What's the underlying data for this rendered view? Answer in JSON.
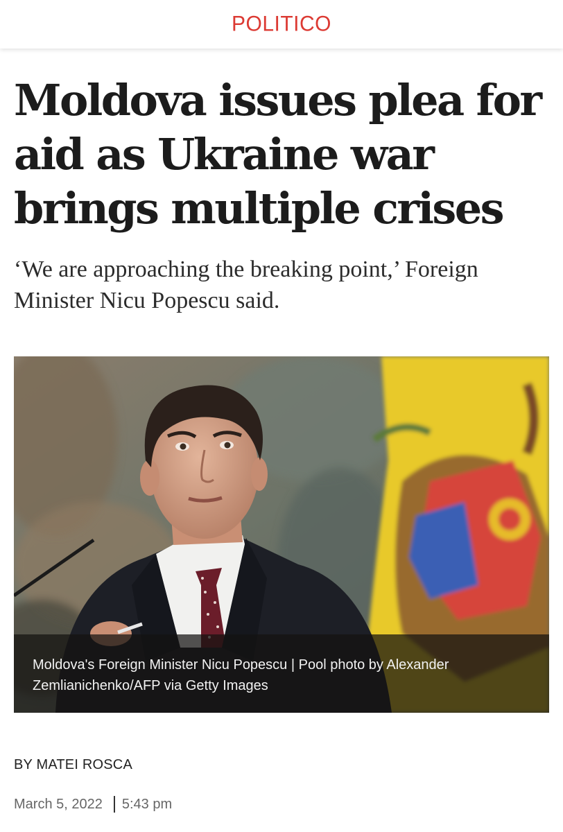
{
  "header": {
    "logo": "POLITICO",
    "brand_color": "#dc3a33"
  },
  "article": {
    "headline": "Moldova issues plea for aid as Ukraine war brings multiple crises",
    "dek": "‘We are approaching the breaking point,’ Foreign Minister Nicu Popescu said.",
    "photo": {
      "subject": "Nicu Popescu in front of the Moldovan flag",
      "caption": "Moldova's Foreign Minister Nicu Popescu | Pool photo by Alexander Zemlianichenko/AFP via Getty Images"
    },
    "byline": "BY MATEI ROSCA",
    "date": "March 5, 2022",
    "time": "5:43 pm"
  }
}
